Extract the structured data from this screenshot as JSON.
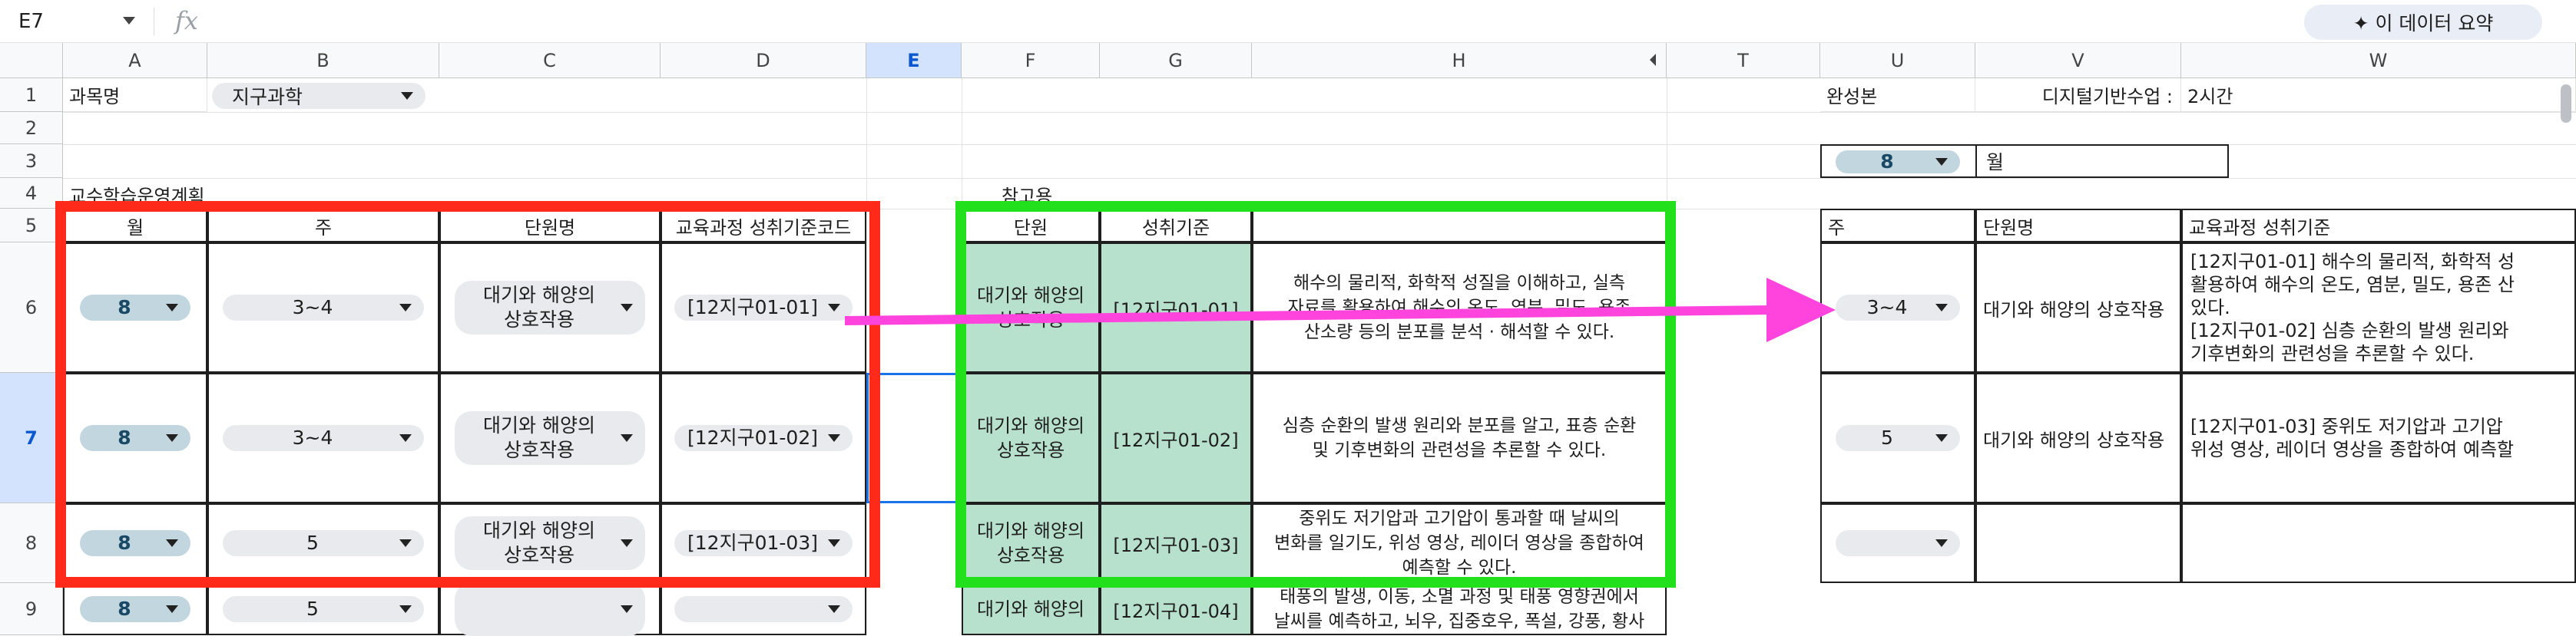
{
  "formula_bar": {
    "name_box": "E7",
    "fx_icon": "fx",
    "summary_button": "✦ 이 데이터 요약"
  },
  "columns": [
    "A",
    "B",
    "C",
    "D",
    "E",
    "F",
    "G",
    "H",
    "T",
    "U",
    "V",
    "W"
  ],
  "rows": [
    "1",
    "2",
    "3",
    "4",
    "5",
    "6",
    "7",
    "8",
    "9"
  ],
  "sheet": {
    "a1": "과목명",
    "b1": "지구과학",
    "a4": "교수학습운영계획",
    "f4": "참고용",
    "u1": "완성본",
    "v1": "디지털기반수업 :",
    "w1": "2시간",
    "u3": "8",
    "v3": "월",
    "headers_left": {
      "month": "월",
      "week": "주",
      "unit": "단원명",
      "code": "교육과정 성취기준코드"
    },
    "headers_ref": {
      "unit": "단원",
      "standard": "성취기준"
    },
    "headers_right": {
      "week": "주",
      "unit": "단원명",
      "standard": "교육과정 성취기준"
    }
  },
  "rows_left": [
    {
      "month": "8",
      "week": "3~4",
      "unit": "대기와 해양의\n상호작용",
      "code": "[12지구01-01]"
    },
    {
      "month": "8",
      "week": "3~4",
      "unit": "대기와 해양의\n상호작용",
      "code": "[12지구01-02]"
    },
    {
      "month": "8",
      "week": "5",
      "unit": "대기와 해양의\n상호작용",
      "code": "[12지구01-03]"
    },
    {
      "month": "8",
      "week": "5",
      "unit": "",
      "code": ""
    }
  ],
  "rows_ref": [
    {
      "unit": "대기와 해양의\n상호작용",
      "code": "[12지구01-01]",
      "desc": "해수의 물리적, 화학적 성질을 이해하고, 실측\n자료를 활용하여 해수의 온도, 염분, 밀도, 용존\n산소량 등의 분포를 분석 · 해석할 수 있다."
    },
    {
      "unit": "대기와 해양의\n상호작용",
      "code": "[12지구01-02]",
      "desc": "심층 순환의 발생 원리와 분포를 알고, 표층 순환\n및 기후변화의 관련성을 추론할 수 있다."
    },
    {
      "unit": "대기와 해양의\n상호작용",
      "code": "[12지구01-03]",
      "desc": "중위도 저기압과 고기압이 통과할 때 날씨의\n변화를 일기도, 위성 영상, 레이더 영상을 종합하여\n예측할 수 있다."
    },
    {
      "unit": "대기와 해양의",
      "code": "[12지구01-04]",
      "desc": "태풍의 발생, 이동, 소멸 과정 및 태풍 영향권에서\n날씨를 예측하고, 뇌우, 집중호우, 폭설, 강풍, 황사"
    }
  ],
  "rows_right": [
    {
      "week": "3~4",
      "unit": "대기와 해양의 상호작용",
      "standard": "[12지구01-01] 해수의 물리적, 화학적 성\n활용하여 해수의 온도, 염분, 밀도, 용존 산\n있다.\n[12지구01-02] 심층 순환의 발생 원리와\n기후변화의 관련성을 추론할 수 있다."
    },
    {
      "week": "5",
      "unit": "대기와 해양의 상호작용",
      "standard": "[12지구01-03] 중위도 저기압과 고기압\n위성 영상, 레이더 영상을 종합하여 예측할"
    },
    {
      "week": "",
      "unit": "",
      "standard": ""
    }
  ],
  "annotation_colors": {
    "red_box": "#ff2a1a",
    "green_box": "#22e01c",
    "arrow": "#ff44dd",
    "selection": "#1a73e8"
  }
}
